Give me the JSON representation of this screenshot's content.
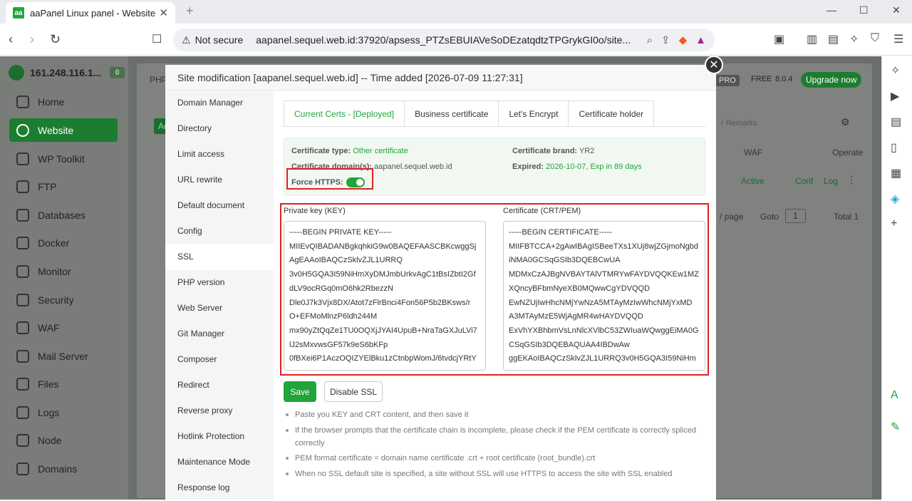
{
  "browser": {
    "tab_title": "aaPanel Linux panel - Website",
    "favicon_text": "aa",
    "not_secure": "Not secure",
    "url": "aapanel.sequel.web.id:37920/apsess_PTZsEBUIAVeSoDEzatqdtzTPGrykGI0o/site..."
  },
  "sidebar": {
    "host": "161.248.116.1...",
    "badge": "0",
    "items": [
      {
        "label": "Home"
      },
      {
        "label": "Website"
      },
      {
        "label": "WP Toolkit"
      },
      {
        "label": "FTP"
      },
      {
        "label": "Databases"
      },
      {
        "label": "Docker"
      },
      {
        "label": "Monitor"
      },
      {
        "label": "Security"
      },
      {
        "label": "WAF"
      },
      {
        "label": "Mail Server"
      },
      {
        "label": "Files"
      },
      {
        "label": "Logs"
      },
      {
        "label": "Node"
      },
      {
        "label": "Domains"
      }
    ]
  },
  "background": {
    "php_tab": "PHP",
    "add_btn": "Ad",
    "pro": "PRO",
    "free": "FREE",
    "version": "8.0.4",
    "upgrade": "Upgrade now",
    "search_placeholder": "r Remarks",
    "col_waf": "WAF",
    "col_operate": "Operate",
    "row_status": "Active",
    "row_conf": "Conf",
    "row_log": "Log",
    "per_page": "/ page",
    "goto": "Goto",
    "goto_value": "1",
    "total": "Total 1"
  },
  "modal": {
    "title": "Site modification [aapanel.sequel.web.id] -- Time added [2026-07-09 11:27:31]",
    "menu": [
      "Domain Manager",
      "Directory",
      "Limit access",
      "URL rewrite",
      "Default document",
      "Config",
      "SSL",
      "PHP version",
      "Web Server",
      "Git Manager",
      "Composer",
      "Redirect",
      "Reverse proxy",
      "Hotlink Protection",
      "Maintenance Mode",
      "Response log"
    ],
    "tabs": [
      "Current Certs - [Deployed]",
      "Business certificate",
      "Let's Encrypt",
      "Certificate holder"
    ],
    "cert_type_label": "Certificate type:",
    "cert_type": "Other certificate",
    "cert_brand_label": "Certificate brand:",
    "cert_brand": "YR2",
    "cert_domain_label": "Certificate domain(s):",
    "cert_domain": "aapanel.sequel.web.id",
    "expired_label": "Expired:",
    "expired": "2026-10-07, Exp in 89 days",
    "force_https": "Force HTTPS:",
    "force_https_on": true,
    "key_label": "Private key (KEY)",
    "cert_label": "Certificate (CRT/PEM)",
    "key_lines": [
      "-----BEGIN PRIVATE KEY-----",
      "MIIEvQIBADANBgkqhkiG9w0BAQEFAASCBKcwggSj",
      "AgEAAoIBAQCzSklvZJL1URRQ",
      "3v0H5GQA3I59NiHmXyDMJmbUrkvAgC1tBsIZbtI2Gf",
      "dLV9ocRGq0mO6hk2RbezzN",
      "Dle0J7k3Vjx8DX/Atot7zFlrBnci4Fon56P5b2BKsws/r",
      "O+EFMoMlnzP6ldh244M",
      "mx90yZtQqZe1TU0OQXjJYAI4UpuB+NraTaGXJuLVi7",
      "lJ2sMxvwsGF57k9eS6bKFp",
      "0fBXei6P1AczOQIZYElBku1zCtnbpWomJ/6tvdcjYRtY"
    ],
    "cert_lines": [
      "-----BEGIN CERTIFICATE-----",
      "MIIFBTCCA+2gAwIBAgISBeeTXs1XUj8wjZGjmoNgbd",
      "iNMA0GCSqGSIb3DQEBCwUA",
      "MDMxCzAJBgNVBAYTAlVTMRYwFAYDVQQKEw1MZ",
      "XQncyBFbmNyeXB0MQwwCgYDVQQD",
      "EwNZUjIwHhcNMjYwNzA5MTAyMzIwWhcNMjYxMD",
      "A3MTAyMzE5WjAgMR4wHAYDVQQD",
      "ExVhYXBhbmVsLnNlcXVlbC53ZWIuaWQwggEiMA0G",
      "CSqGSIb3DQEBAQUAA4IBDwAw",
      "ggEKAoIBAQCzSklvZJL1URRQ3v0H5GQA3I59NiHm"
    ],
    "save": "Save",
    "disable": "Disable SSL",
    "tips": [
      "Paste you KEY and CRT content, and then save it",
      "If the browser prompts that the certificate chain is incomplete, please check if the PEM certificate is correctly spliced correctly",
      "PEM format certificate = domain name certificate .crt + root certificate (root_bundle).crt",
      "When no SSL default site is specified, a site without SSL will use HTTPS to access the site with SSL enabled"
    ]
  },
  "colors": {
    "accent": "#20a53a",
    "highlight": "#e02020"
  }
}
